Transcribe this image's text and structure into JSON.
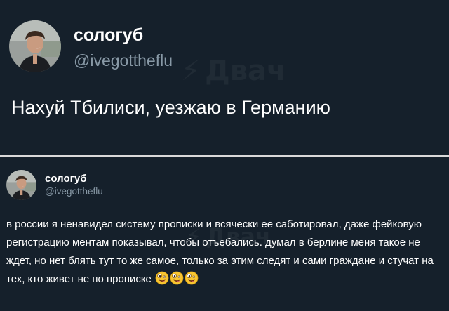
{
  "tweet_main": {
    "author_name": "сологуб",
    "author_handle": "@ivegottheflu",
    "text": "Нахуй Тбилиси, уезжаю в Германию"
  },
  "tweet_reply": {
    "author_name": "сологуб",
    "author_handle": "@ivegottheflu",
    "text": "в россии я ненавидел систему прописки и всячески ее саботировал, даже фейковую регистрацию ментам показывал, чтобы отъебались. думал в берлине меня такое не ждет, но нет блять тут то же самое, только за этим следят и сами граждане и стучат на тех, кто живет не по прописке",
    "emojis": [
      "zany-face-emoji",
      "zany-face-emoji",
      "zany-face-emoji"
    ]
  },
  "watermark": {
    "text": "Двач"
  },
  "colors": {
    "background": "#15202b",
    "text_primary": "#ffffff",
    "text_secondary": "#8899a6",
    "divider": "#d9d9d9"
  }
}
